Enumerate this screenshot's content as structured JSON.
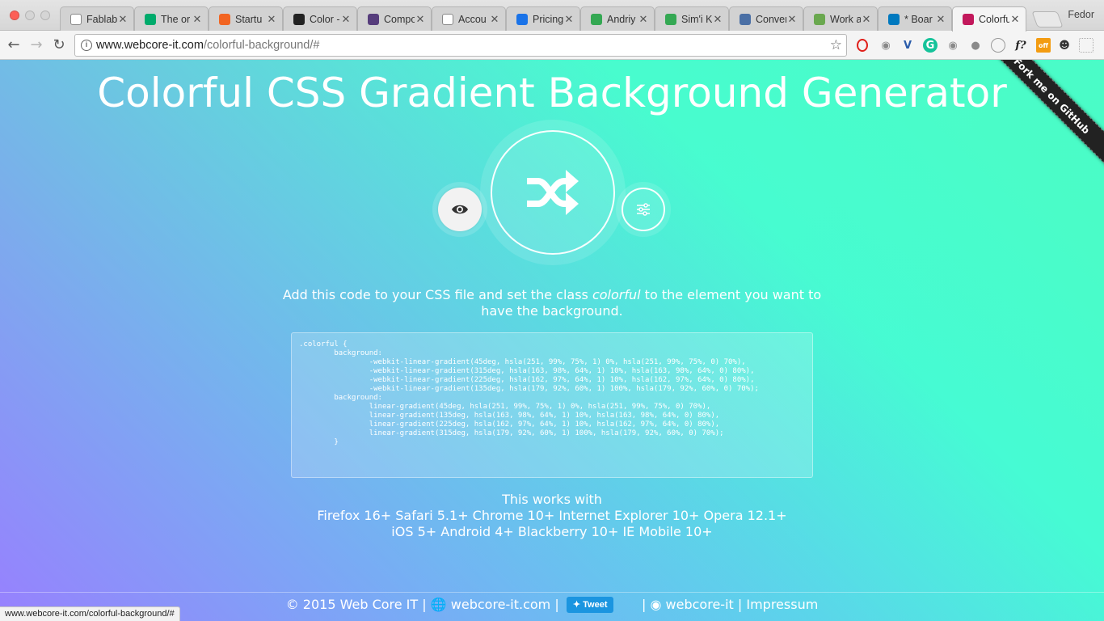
{
  "browser": {
    "tabs": [
      {
        "label": "Fablab",
        "icon": "document-icon",
        "color": "#ffffff"
      },
      {
        "label": "The or",
        "icon": "medium-icon",
        "color": "#00ab6c"
      },
      {
        "label": "Startu",
        "icon": "ycombinator-icon",
        "color": "#f26522"
      },
      {
        "label": "Color -",
        "icon": "flag-icon",
        "color": "#222222"
      },
      {
        "label": "Compo",
        "icon": "bootstrap-icon",
        "color": "#563d7c"
      },
      {
        "label": "Accou",
        "icon": "document-icon",
        "color": "#ffffff"
      },
      {
        "label": "Pricing",
        "icon": "loading-icon",
        "color": "#1a73e8"
      },
      {
        "label": "Andriy",
        "icon": "maps-icon",
        "color": "#34a853"
      },
      {
        "label": "Sim'i K",
        "icon": "maps-icon",
        "color": "#34a853"
      },
      {
        "label": "Conver",
        "icon": "chat-icon",
        "color": "#4a6fa5"
      },
      {
        "label": "Work a",
        "icon": "globe-icon",
        "color": "#6aa84f"
      },
      {
        "label": "* Boar",
        "icon": "trello-icon",
        "color": "#0079bf"
      },
      {
        "label": "Colorfu",
        "icon": "colorful-icon",
        "color": "#c2185b"
      }
    ],
    "profile_name": "Fedor",
    "address": {
      "host": "www.webcore-it.com",
      "path": "/colorful-background/#"
    },
    "status_url": "www.webcore-it.com/colorful-background/#"
  },
  "page": {
    "title": "Colorful CSS Gradient Background Generator",
    "fork_ribbon": "Fork me on GitHub",
    "instructions_before": "Add this code to your CSS file and set the class ",
    "instructions_class": "colorful",
    "instructions_after": " to the element you want to have the background.",
    "code": ".colorful {\n        background:\n                -webkit-linear-gradient(45deg, hsla(251, 99%, 75%, 1) 0%, hsla(251, 99%, 75%, 0) 70%),\n                -webkit-linear-gradient(315deg, hsla(163, 98%, 64%, 1) 10%, hsla(163, 98%, 64%, 0) 80%),\n                -webkit-linear-gradient(225deg, hsla(162, 97%, 64%, 1) 10%, hsla(162, 97%, 64%, 0) 80%),\n                -webkit-linear-gradient(135deg, hsla(179, 92%, 60%, 1) 100%, hsla(179, 92%, 60%, 0) 70%);\n        background:\n                linear-gradient(45deg, hsla(251, 99%, 75%, 1) 0%, hsla(251, 99%, 75%, 0) 70%),\n                linear-gradient(135deg, hsla(163, 98%, 64%, 1) 10%, hsla(163, 98%, 64%, 0) 80%),\n                linear-gradient(225deg, hsla(162, 97%, 64%, 1) 10%, hsla(162, 97%, 64%, 0) 80%),\n                linear-gradient(315deg, hsla(179, 92%, 60%, 1) 100%, hsla(179, 92%, 60%, 0) 70%);\n        }",
    "works_with": "This works with",
    "browsers_line1": "Firefox 16+ Safari 5.1+ Chrome 10+ Internet Explorer 10+ Opera 12.1+",
    "browsers_line2": "iOS 5+ Android 4+ Blackberry 10+ IE Mobile 10+"
  },
  "footer": {
    "copyright": "© 2015 Web Core IT",
    "site_link": "webcore-it.com",
    "tweet_label": "Tweet",
    "github_link": "webcore-it",
    "impressum": "Impressum"
  },
  "colors": {
    "accent_white": "#ffffff",
    "tweet_blue": "#1b95e0"
  }
}
